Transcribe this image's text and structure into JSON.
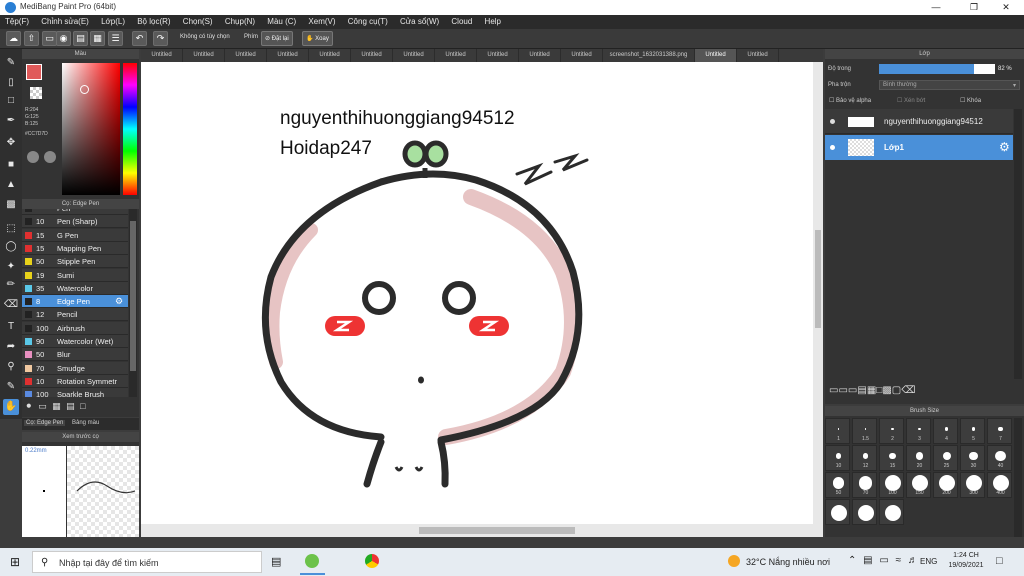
{
  "window": {
    "title": "MediBang Paint Pro (64bit)"
  },
  "menu": [
    "Tệp(F)",
    "Chỉnh sửa(E)",
    "Lớp(L)",
    "Bộ lọc(R)",
    "Chọn(S)",
    "Chụp(N)",
    "Màu (C)",
    "Xem(V)",
    "Công cụ(T)",
    "Cửa sổ(W)",
    "Cloud",
    "Help"
  ],
  "toolbar": {
    "label_custom": "Không có tùy chọn",
    "label_keys": "Phím",
    "flip_label": "Đặt lại",
    "rotate_label": "Xoay"
  },
  "color_panel": {
    "title": "Màu",
    "r": "R:204",
    "g": "G:125",
    "b": "B:125",
    "hex": "#CC7D7D",
    "main_color": "#e05a5a"
  },
  "brush_panel": {
    "title": "Cọ: Edge Pen",
    "items": [
      {
        "size": "",
        "name": "Pen",
        "color": "#222222"
      },
      {
        "size": "10",
        "name": "Pen (Sharp)",
        "color": "#222222"
      },
      {
        "size": "15",
        "name": "G Pen",
        "color": "#e03030"
      },
      {
        "size": "15",
        "name": "Mapping Pen",
        "color": "#e03030"
      },
      {
        "size": "50",
        "name": "Stipple Pen",
        "color": "#e8d21a"
      },
      {
        "size": "19",
        "name": "Sumi",
        "color": "#e8d21a"
      },
      {
        "size": "35",
        "name": "Watercolor",
        "color": "#5ac8e8"
      },
      {
        "size": "8",
        "name": "Edge Pen",
        "color": "#222222"
      },
      {
        "size": "12",
        "name": "Pencil",
        "color": "#222222"
      },
      {
        "size": "100",
        "name": "Airbrush",
        "color": "#222222"
      },
      {
        "size": "90",
        "name": "Watercolor (Wet)",
        "color": "#5ac8e8"
      },
      {
        "size": "50",
        "name": "Blur",
        "color": "#e890c0"
      },
      {
        "size": "70",
        "name": "Smudge",
        "color": "#f0c8a0"
      },
      {
        "size": "10",
        "name": "Rotation Symmetr",
        "color": "#e03030"
      },
      {
        "size": "100",
        "name": "Sparkle Brush",
        "color": "#5a8ae0"
      }
    ],
    "tab1": "Cọ: Edge Pen",
    "tab2": "Bảng màu"
  },
  "preview_panel": {
    "title": "Xem trước cọ",
    "size": "0.22mm"
  },
  "doc_tabs": [
    "Untitled",
    "Untitled",
    "Untitled",
    "Untitled",
    "Untitled",
    "Untitled",
    "Untitled",
    "Untitled",
    "Untitled",
    "Untitled",
    "Untitled",
    "screenshot_1632031388.png",
    "Untitled",
    "Untitled"
  ],
  "canvas": {
    "line1": "nguyenthihuonggiang94512",
    "line2": "Hoidap247"
  },
  "layer_panel": {
    "title": "Lớp",
    "opacity_label": "Độ trong",
    "opacity_value": "82 %",
    "opacity_fraction": 0.82,
    "blend_label": "Pha trộn",
    "blend_value": "Bình thường",
    "protect_alpha": "Bảo vệ alpha",
    "clipping": "Xén bớt",
    "lock": "Khóa",
    "layers": [
      {
        "name": "nguyenthihuonggiang94512",
        "selected": false
      },
      {
        "name": "Lớp1",
        "selected": true
      }
    ]
  },
  "brush_size_panel": {
    "title": "Brush Size",
    "sizes": [
      "1",
      "1.5",
      "2",
      "3",
      "4",
      "5",
      "7",
      "10",
      "12",
      "15",
      "20",
      "25",
      "30",
      "40",
      "50",
      "70",
      "100",
      "150",
      "200",
      "300",
      "400",
      "",
      "",
      ""
    ]
  },
  "taskbar": {
    "search_placeholder": "Nhập tại đây để tìm kiếm",
    "weather": "32°C  Nắng nhiều nơi",
    "lang": "ENG",
    "time": "1:24 CH",
    "date": "19/09/2021"
  },
  "colors": {
    "accent": "#4a90d9",
    "panel": "#333333",
    "blush": "#ee3333",
    "shadow": "#e7c4c4",
    "leaf": "#a8e0a0"
  }
}
